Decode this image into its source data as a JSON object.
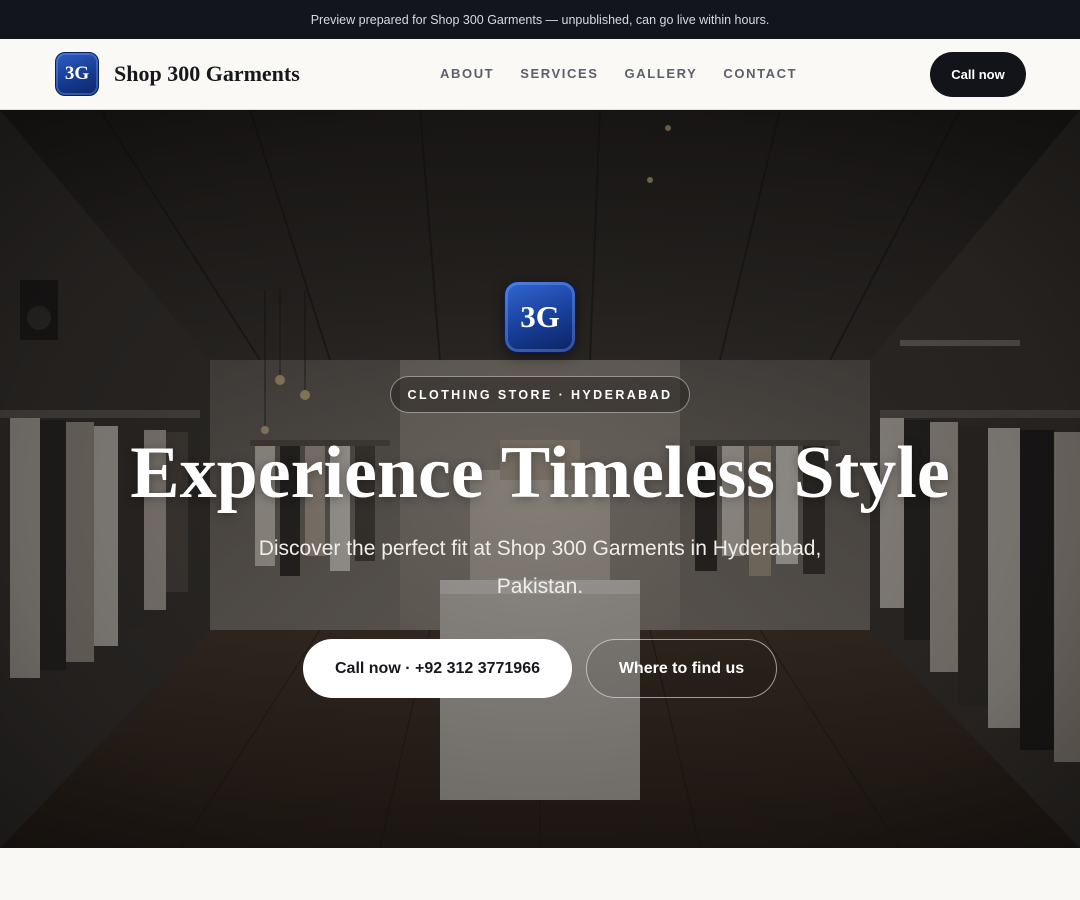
{
  "preview_bar": {
    "text": "Preview prepared for Shop 300 Garments — unpublished, can go live within hours."
  },
  "header": {
    "logo_text": "3G",
    "brand_name": "Shop 300 Garments",
    "nav": [
      {
        "label": "ABOUT"
      },
      {
        "label": "SERVICES"
      },
      {
        "label": "GALLERY"
      },
      {
        "label": "CONTACT"
      }
    ],
    "call_label": "Call now"
  },
  "hero": {
    "logo_text": "3G",
    "tag": "CLOTHING STORE · HYDERABAD",
    "title": "Experience Timeless Style",
    "subtitle": "Discover the perfect fit at Shop 300 Garments in Hyderabad, Pakistan.",
    "primary_button": "Call now · +92 312 3771966",
    "secondary_button": "Where to find us"
  },
  "colors": {
    "dark": "#12141a",
    "logo_blue": "#173e98",
    "page_bg": "#f9f8f5"
  }
}
